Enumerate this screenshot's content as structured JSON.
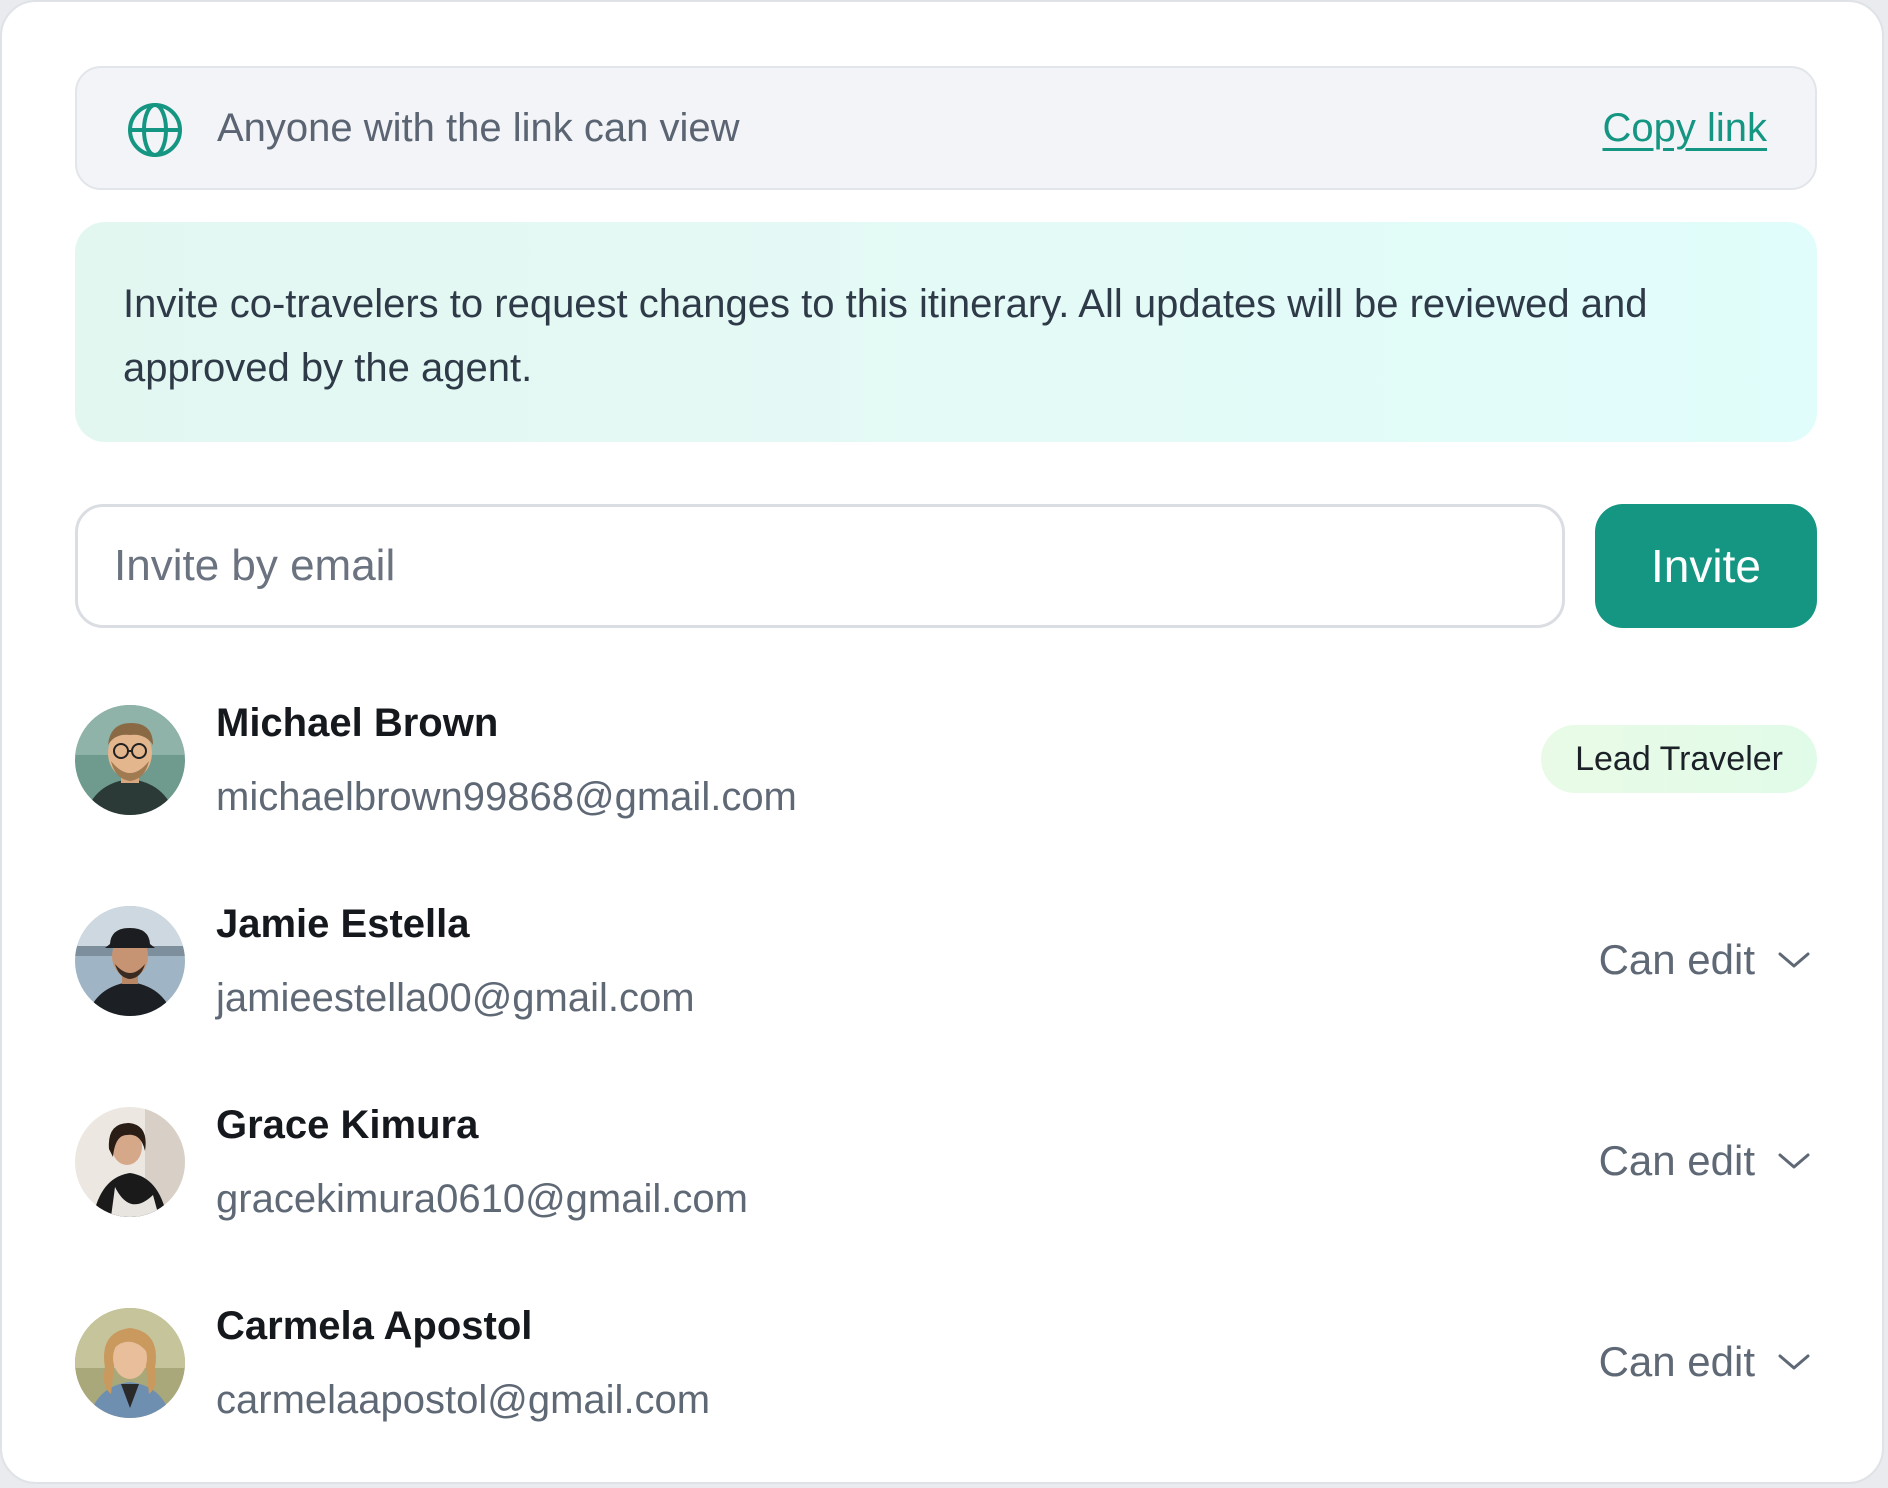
{
  "share_link": {
    "text": "Anyone with the link can view",
    "copy_label": "Copy link",
    "icon": "globe-icon",
    "accent_color": "#159682"
  },
  "notice": {
    "text": "Invite co-travelers to request changes to this itinerary. All updates will be reviewed and approved by the agent."
  },
  "invite": {
    "placeholder": "Invite by email",
    "value": "",
    "button_label": "Invite",
    "button_color": "#149682"
  },
  "members": [
    {
      "name": "Michael Brown",
      "email": "michaelbrown99868@gmail.com",
      "role": "Lead Traveler",
      "role_type": "badge"
    },
    {
      "name": "Jamie Estella",
      "email": "jamieestella00@gmail.com",
      "role": "Can edit",
      "role_type": "dropdown"
    },
    {
      "name": "Grace Kimura",
      "email": "gracekimura0610@gmail.com",
      "role": "Can edit",
      "role_type": "dropdown"
    },
    {
      "name": "Carmela Apostol",
      "email": "carmelaapostol@gmail.com",
      "role": "Can edit",
      "role_type": "dropdown"
    }
  ]
}
